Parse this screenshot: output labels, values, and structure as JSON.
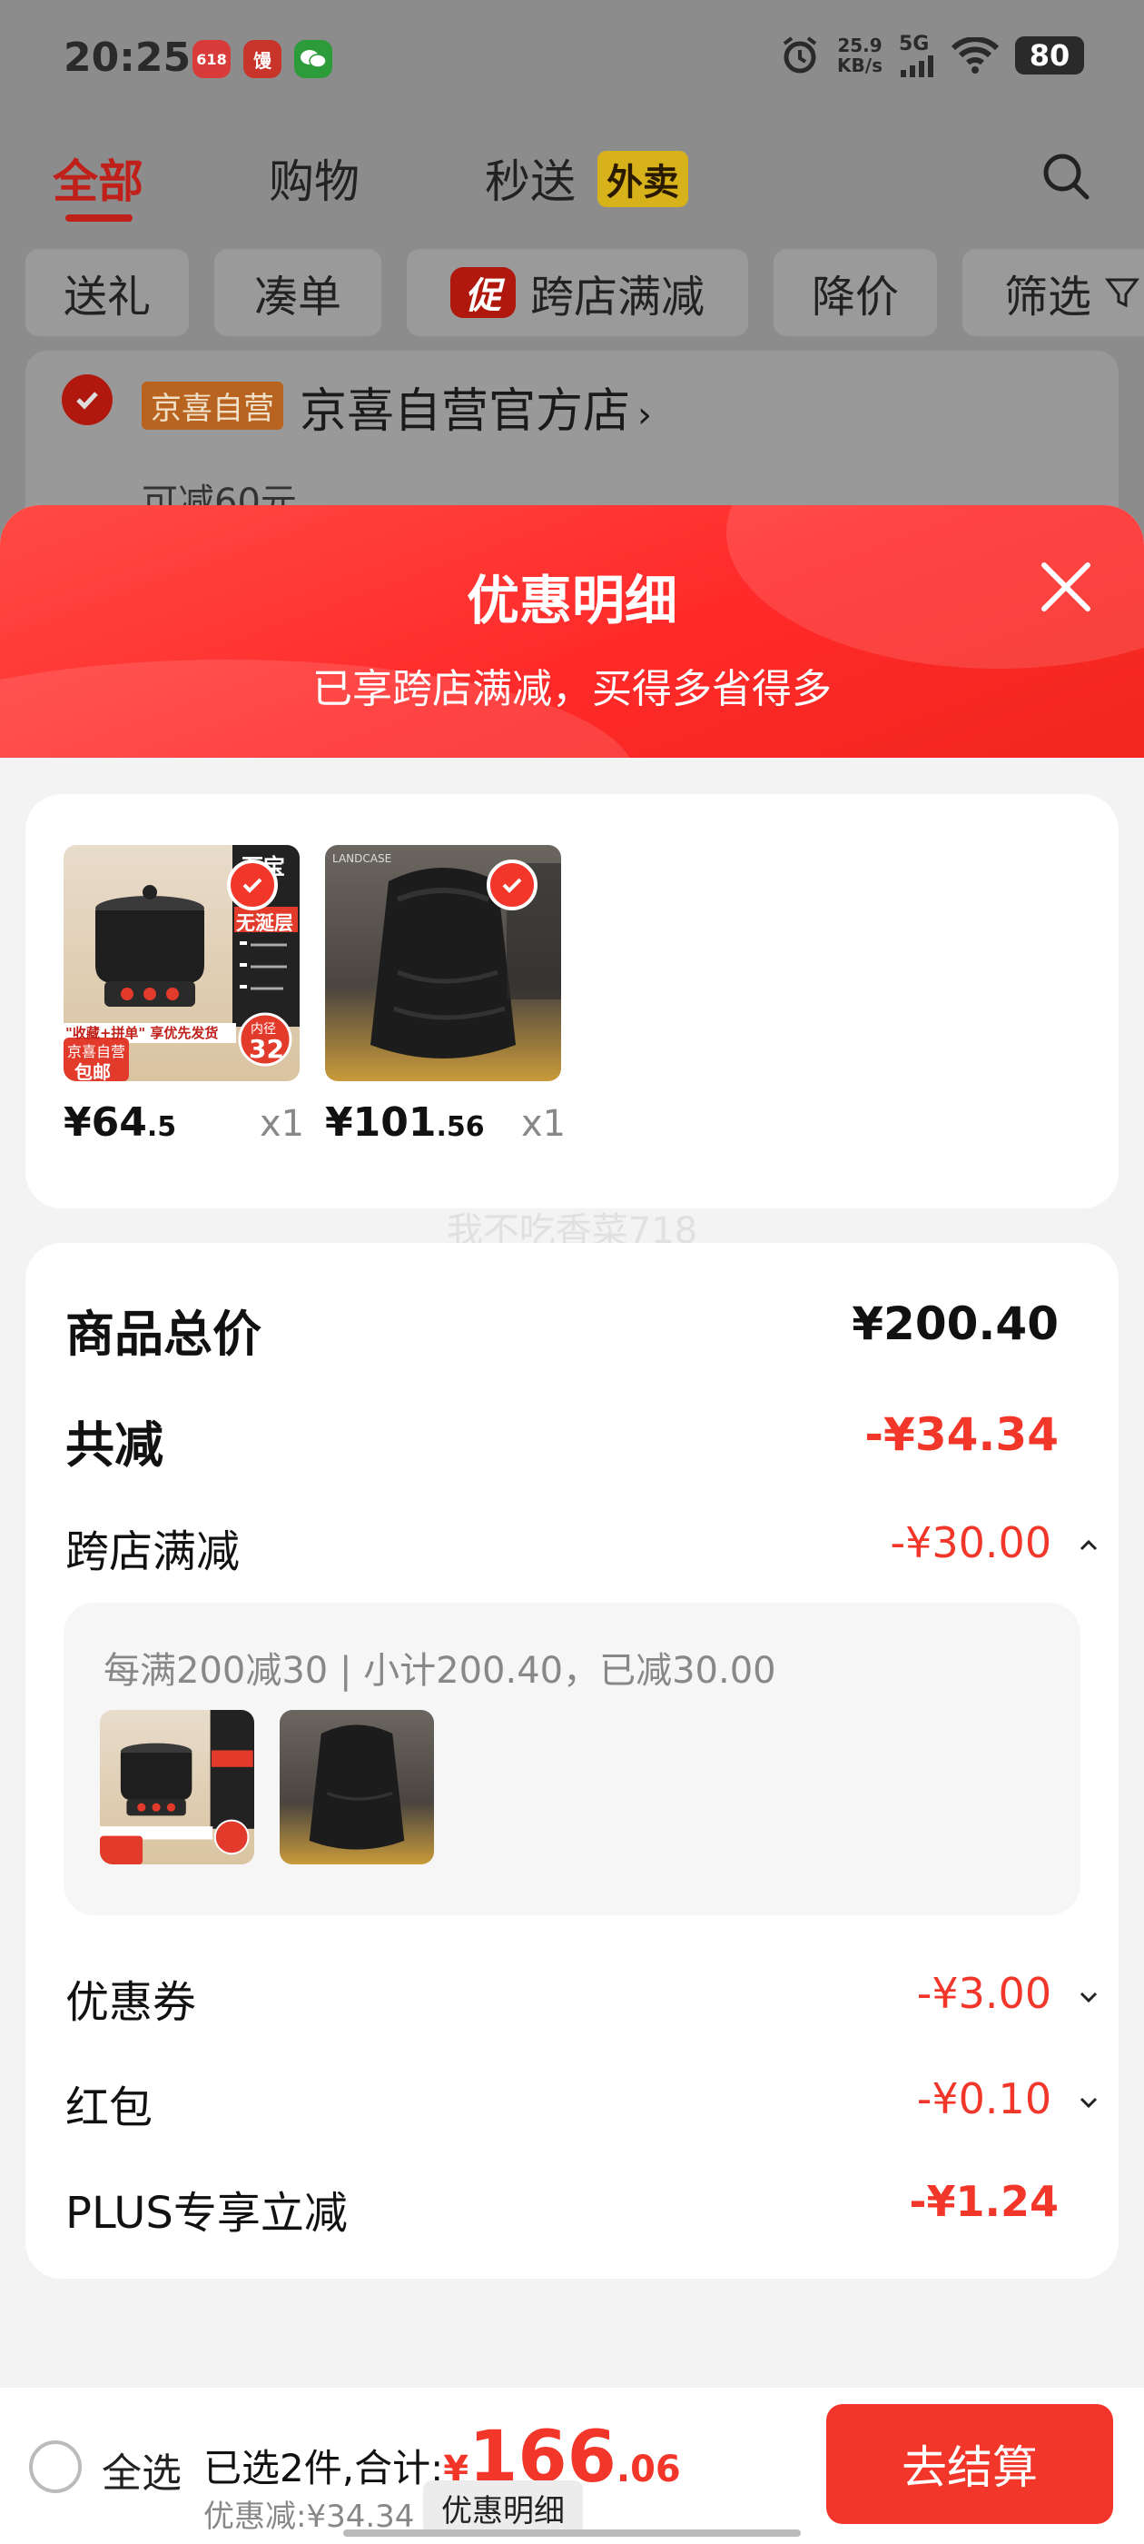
{
  "status_bar": {
    "time": "20:25",
    "net_speed_value": "25.9",
    "net_speed_unit": "KB/s",
    "network": "5G",
    "battery": "80",
    "app_icons": [
      "618-app-icon",
      "food-app-icon",
      "wechat-icon"
    ],
    "app_icon_texts": [
      "618",
      "馒"
    ]
  },
  "top_tabs": {
    "all": "全部",
    "shopping": "购物",
    "express": "秒送",
    "takeout_badge": "外卖"
  },
  "filters": {
    "gift": "送礼",
    "bundle": "凑单",
    "promo_badge": "促",
    "cross_store": "跨店满减",
    "price_drop": "降价",
    "filter": "筛选"
  },
  "store": {
    "badge": "京喜自营",
    "name": "京喜自营官方店",
    "reduce_hint": "可减60元"
  },
  "sheet": {
    "title": "优惠明细",
    "subtitle": "已享跨店满减，买得多省得多",
    "watermark": "我不吃香菜718"
  },
  "products": [
    {
      "price_int": "¥64",
      "price_dec": ".5",
      "qty": "x1",
      "image": "rice-cooker-image",
      "img_texts": {
        "brand": "万宝",
        "tag": "无涎层",
        "banner": "\"收藏+拼单\" 享优先发货",
        "ship1": "京喜自营",
        "ship2": "包邮",
        "size": "内径",
        "size_num": "32"
      }
    },
    {
      "price_int": "¥101",
      "price_dec": ".56",
      "qty": "x1",
      "image": "black-backpack-image",
      "img_texts": {
        "brand": "LANDCASE"
      }
    }
  ],
  "details": {
    "total_label": "商品总价",
    "total_value": "¥200.40",
    "reduce_label": "共减",
    "reduce_value": "-¥34.34",
    "cross_label": "跨店满减",
    "cross_value": "-¥30.00",
    "rule_text": "每满200减30 | 小计200.40，已减30.00",
    "coupon_label": "优惠券",
    "coupon_value": "-¥3.00",
    "redpacket_label": "红包",
    "redpacket_value": "-¥0.10",
    "plus_label": "PLUS专享立减",
    "plus_value": "-¥1.24"
  },
  "bottom": {
    "select_all": "全选",
    "summary_prefix": "已选2件,合计:",
    "total_symbol": "¥",
    "total_int": "166",
    "total_dec": ".06",
    "discount": "优惠减:¥34.34",
    "detail_button": "优惠明细",
    "checkout": "去结算"
  },
  "colors": {
    "accent": "#f2362a",
    "overlay_tab_active": "#c0201a"
  }
}
